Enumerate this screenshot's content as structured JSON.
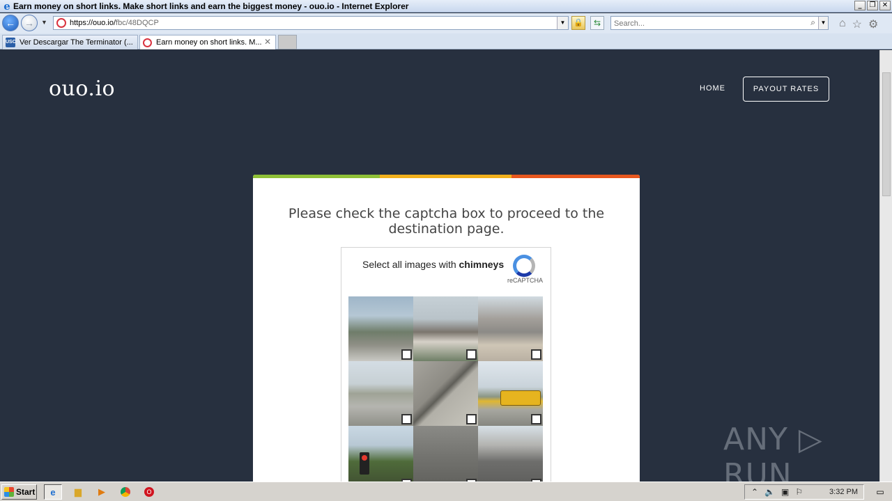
{
  "window": {
    "title": "Earn money on short links. Make short links and earn the biggest money - ouo.io - Internet Explorer",
    "buttons": [
      "_",
      "❐",
      "✕"
    ]
  },
  "addressbar": {
    "url_host": "https://ouo.io/",
    "url_path": "fbc/48DQCP",
    "search_placeholder": "Search..."
  },
  "tabs": [
    {
      "label": "Ver Descargar The Terminator (...",
      "icon": "usc-icon",
      "icon_text": "USC",
      "active": false
    },
    {
      "label": "Earn money on short links. M...",
      "icon": "ouo-icon",
      "active": true
    }
  ],
  "site": {
    "logo": "ouo.io",
    "nav": {
      "home": "HOME",
      "payout": "PAYOUT RATES"
    },
    "message": "Please check the captcha box to proceed to the destination page.",
    "stripe_colors": [
      "#8fc037",
      "#f2b01b",
      "#e8571e"
    ]
  },
  "captcha": {
    "prompt_prefix": "Select all images with ",
    "prompt_target": "chimneys",
    "brand": "reCAPTCHA",
    "tiles": 9
  },
  "watermark": "ANY ▷ RUN",
  "taskbar": {
    "start": "Start",
    "clock": "3:32 PM"
  }
}
